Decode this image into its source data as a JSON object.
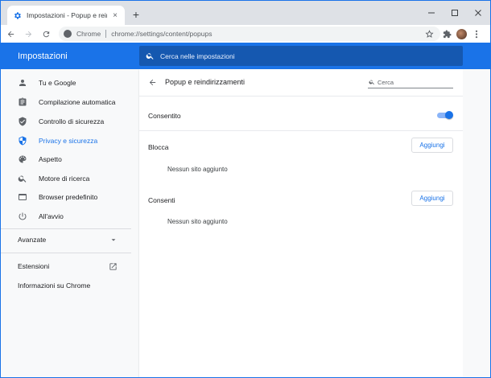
{
  "browser": {
    "tab_title": "Impostazioni - Popup e reindirizz",
    "tab_close": "×",
    "new_tab": "+",
    "omnibox_chip": "Chrome",
    "url": "chrome://settings/content/popups"
  },
  "header": {
    "title": "Impostazioni",
    "search_placeholder": "Cerca nelle impostazioni"
  },
  "sidebar": {
    "items": [
      {
        "label": "Tu e Google",
        "icon": "person-icon"
      },
      {
        "label": "Compilazione automatica",
        "icon": "clipboard-icon"
      },
      {
        "label": "Controllo di sicurezza",
        "icon": "shield-check-icon"
      },
      {
        "label": "Privacy e sicurezza",
        "icon": "shield-icon",
        "active": true
      },
      {
        "label": "Aspetto",
        "icon": "palette-icon"
      },
      {
        "label": "Motore di ricerca",
        "icon": "search-icon"
      },
      {
        "label": "Browser predefinito",
        "icon": "browser-icon"
      },
      {
        "label": "All'avvio",
        "icon": "power-icon"
      }
    ],
    "advanced": "Avanzate",
    "extensions": "Estensioni",
    "about": "Informazioni su Chrome"
  },
  "main": {
    "title": "Popup e reindirizzamenti",
    "search_placeholder": "Cerca",
    "allowed_label": "Consentito",
    "allowed_on": true,
    "block_section": "Blocca",
    "block_add": "Aggiungi",
    "block_empty": "Nessun sito aggiunto",
    "allow_section": "Consenti",
    "allow_add": "Aggiungi",
    "allow_empty": "Nessun sito aggiunto"
  },
  "colors": {
    "accent": "#1a73e8",
    "header_bg": "#1a73e8",
    "search_bg": "#1558b0"
  }
}
